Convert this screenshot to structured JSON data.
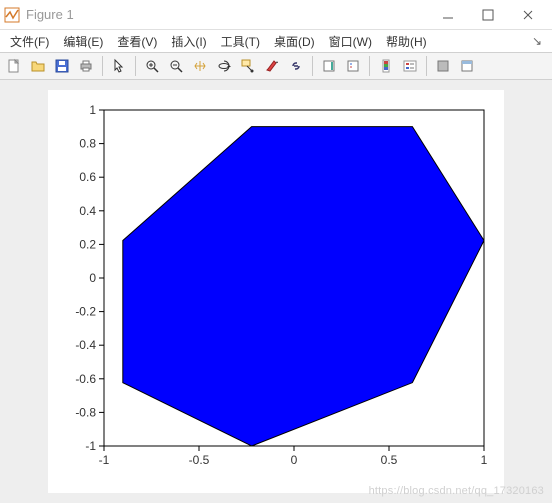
{
  "window": {
    "title": "Figure 1"
  },
  "menu": {
    "items": [
      "文件(F)",
      "编辑(E)",
      "查看(V)",
      "插入(I)",
      "工具(T)",
      "桌面(D)",
      "窗口(W)",
      "帮助(H)"
    ]
  },
  "toolbar": {
    "icons": [
      "new",
      "open",
      "save",
      "print",
      "arrow",
      "zoom-in",
      "zoom-out",
      "pan",
      "rotate3d",
      "datacursor",
      "brush",
      "link",
      "colorbar",
      "legend",
      "insert-colorbar",
      "insert-legend"
    ]
  },
  "chart_data": {
    "type": "polygon",
    "title": "",
    "xlabel": "",
    "ylabel": "",
    "xlim": [
      -1,
      1
    ],
    "ylim": [
      -1,
      1
    ],
    "x_ticks": [
      -1,
      -0.5,
      0,
      0.5,
      1
    ],
    "y_ticks": [
      -1,
      -0.8,
      -0.6,
      -0.4,
      -0.2,
      0,
      0.2,
      0.4,
      0.6,
      0.8,
      1
    ],
    "fill_color": "#0000ff",
    "edge_color": "#000000",
    "vertices": [
      [
        1.0,
        0.223
      ],
      [
        0.623,
        0.901
      ],
      [
        -0.223,
        0.901
      ],
      [
        -0.901,
        0.223
      ],
      [
        -0.901,
        -0.623
      ],
      [
        -0.223,
        -1.0
      ],
      [
        0.623,
        -0.623
      ]
    ]
  },
  "watermark": "https://blog.csdn.net/qq_17320163"
}
